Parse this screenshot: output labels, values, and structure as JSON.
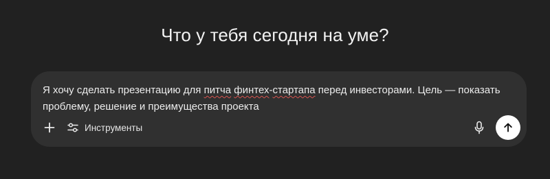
{
  "header": {
    "title": "Что у тебя сегодня на уме?"
  },
  "composer": {
    "text_parts": [
      "Я хочу сделать презентацию для ",
      "питча",
      " ",
      "финтех",
      "-",
      "стартапа",
      " перед инвесторами. Цель — показать проблему, решение и преимущества проекта"
    ],
    "tools_label": "Инструменты",
    "icons": {
      "add": "plus-icon",
      "tools": "sliders-icon",
      "mic": "microphone-icon",
      "send": "arrow-up-icon"
    }
  },
  "colors": {
    "background": "#212121",
    "composer": "#303030",
    "text": "#ececec",
    "send_button": "#ffffff",
    "spellcheck": "#d9534f"
  }
}
